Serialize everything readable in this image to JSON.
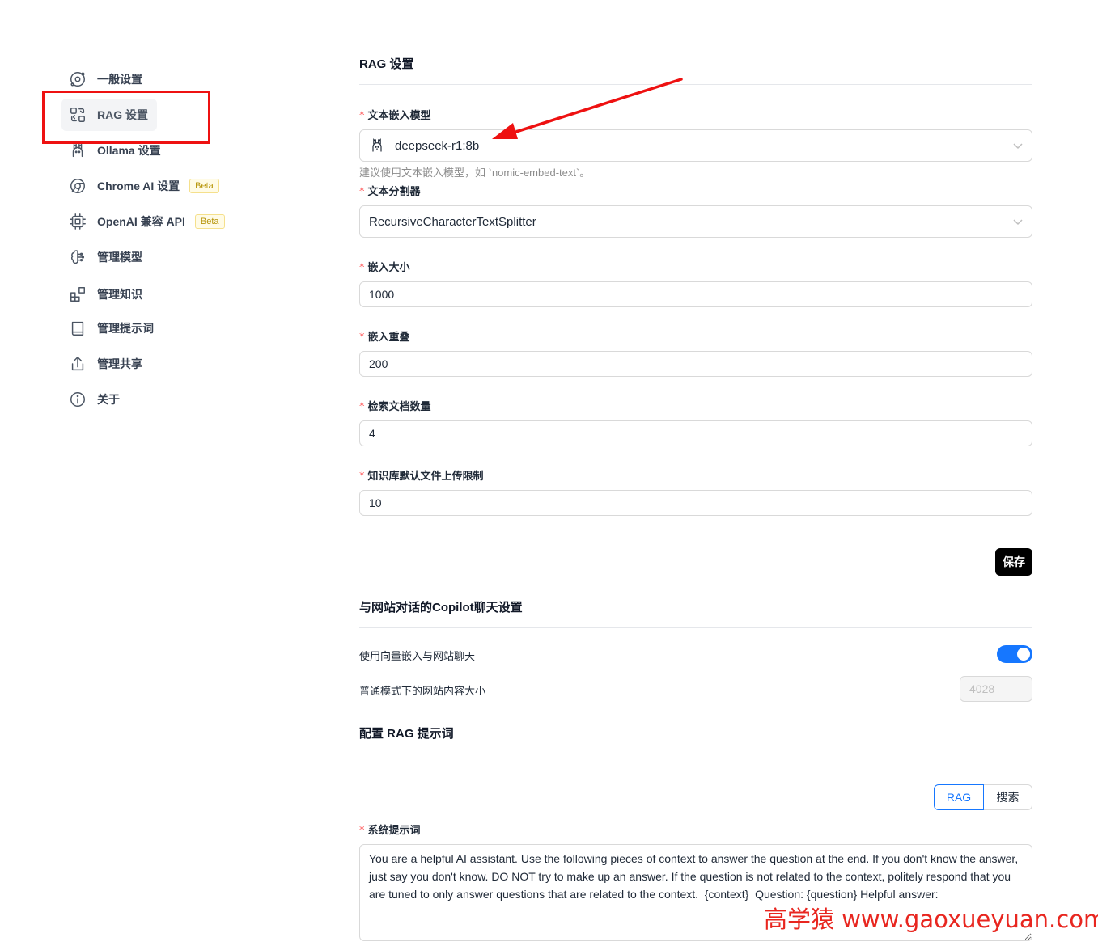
{
  "sidebar": {
    "items": [
      {
        "label": "一般设置",
        "icon": "orbit-icon"
      },
      {
        "label": "RAG 设置",
        "icon": "rag-icon"
      },
      {
        "label": "Ollama 设置",
        "icon": "llama-icon"
      },
      {
        "label": "Chrome AI 设置",
        "icon": "chrome-icon",
        "badge": "Beta"
      },
      {
        "label": "OpenAI 兼容 API",
        "icon": "cpu-icon",
        "badge": "Beta"
      },
      {
        "label": "管理模型",
        "icon": "brain-icon"
      },
      {
        "label": "管理知识",
        "icon": "blocks-icon"
      },
      {
        "label": "管理提示词",
        "icon": "book-icon"
      },
      {
        "label": "管理共享",
        "icon": "share-icon"
      },
      {
        "label": "关于",
        "icon": "info-icon"
      }
    ],
    "active_index": 1
  },
  "rag": {
    "title": "RAG 设置",
    "embedding_model": {
      "label": "文本嵌入模型",
      "value": "deepseek-r1:8b",
      "hint": "建议使用文本嵌入模型，如 `nomic-embed-text`。"
    },
    "splitter": {
      "label": "文本分割器",
      "value": "RecursiveCharacterTextSplitter"
    },
    "chunk_size": {
      "label": "嵌入大小",
      "value": "1000"
    },
    "chunk_overlap": {
      "label": "嵌入重叠",
      "value": "200"
    },
    "doc_count": {
      "label": "检索文档数量",
      "value": "4"
    },
    "upload_limit": {
      "label": "知识库默认文件上传限制",
      "value": "10"
    },
    "save_label": "保存"
  },
  "copilot": {
    "title": "与网站对话的Copilot聊天设置",
    "vector_label": "使用向量嵌入与网站聊天",
    "vector_enabled": true,
    "content_size_label": "普通模式下的网站内容大小",
    "content_size_value": "4028"
  },
  "prompt": {
    "title": "配置 RAG 提示词",
    "tabs": [
      "RAG",
      "搜索"
    ],
    "active_tab": 0,
    "system_label": "系统提示词",
    "system_value": "You are a helpful AI assistant. Use the following pieces of context to answer the question at the end. If you don't know the answer, just say you don't know. DO NOT try to make up an answer. If the question is not related to the context, politely respond that you are tuned to only answer questions that are related to the context.  {context}  Question: {question} Helpful answer:"
  },
  "watermark": "高学猿 www.gaoxueyuan.com",
  "colors": {
    "accent": "#1677ff",
    "annotation": "#ee1111",
    "badge": "#b7950b"
  }
}
